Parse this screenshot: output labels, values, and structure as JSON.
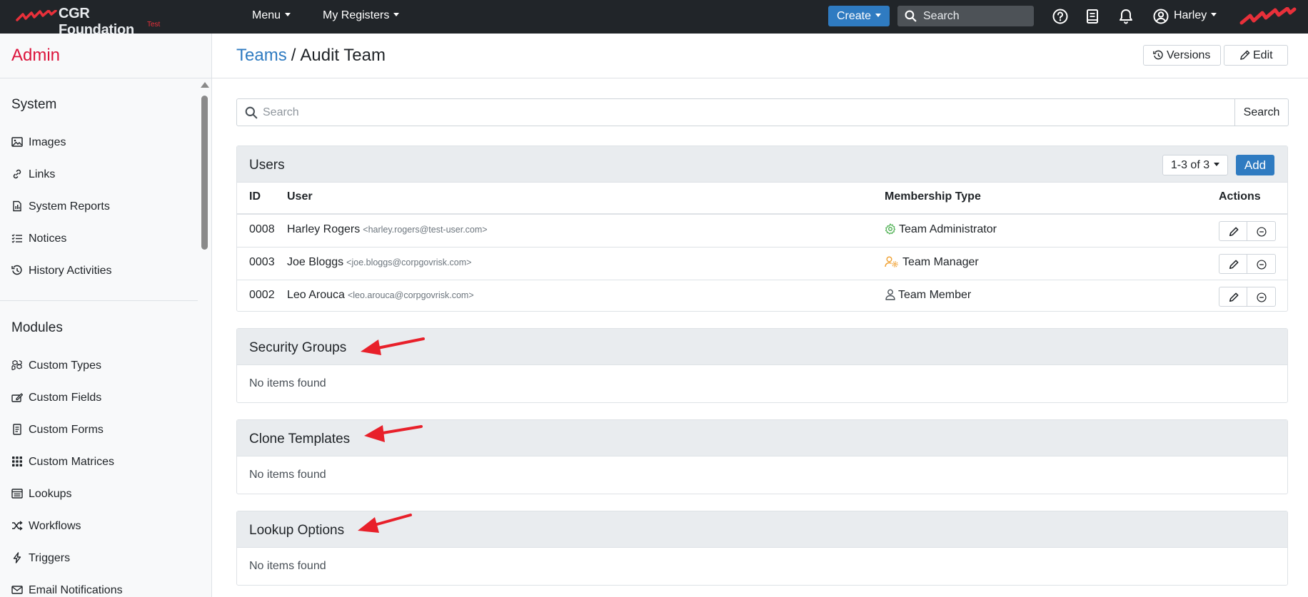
{
  "navbar": {
    "brand_name": "CGR Foundation",
    "brand_env": "Test",
    "menu_label": "Menu",
    "registers_label": "My Registers",
    "create_label": "Create",
    "search_placeholder": "Search",
    "user_label": "Harley",
    "icons": [
      "help-icon",
      "book-icon",
      "bell-icon",
      "user-circle-icon"
    ]
  },
  "sidebar": {
    "title": "Admin",
    "sections": [
      {
        "heading": "System",
        "items": [
          {
            "label": "Images",
            "icon": "image-icon"
          },
          {
            "label": "Links",
            "icon": "link-icon"
          },
          {
            "label": "System Reports",
            "icon": "report-icon"
          },
          {
            "label": "Notices",
            "icon": "list-check-icon"
          },
          {
            "label": "History Activities",
            "icon": "history-icon"
          }
        ]
      },
      {
        "heading": "Modules",
        "items": [
          {
            "label": "Custom Types",
            "icon": "boxes-icon"
          },
          {
            "label": "Custom Fields",
            "icon": "edit-field-icon"
          },
          {
            "label": "Custom Forms",
            "icon": "form-icon"
          },
          {
            "label": "Custom Matrices",
            "icon": "grid-icon"
          },
          {
            "label": "Lookups",
            "icon": "lookup-icon"
          },
          {
            "label": "Workflows",
            "icon": "shuffle-icon"
          },
          {
            "label": "Triggers",
            "icon": "lightning-icon"
          },
          {
            "label": "Email Notifications",
            "icon": "envelope-icon"
          }
        ]
      }
    ]
  },
  "header": {
    "breadcrumb_parent": "Teams",
    "breadcrumb_separator": "/",
    "breadcrumb_current": "Audit Team",
    "versions_label": "Versions",
    "edit_label": "Edit"
  },
  "search": {
    "placeholder": "Search",
    "button_label": "Search"
  },
  "users_panel": {
    "title": "Users",
    "pager_label": "1-3 of 3",
    "add_label": "Add",
    "columns": [
      "ID",
      "User",
      "Membership Type",
      "Actions"
    ],
    "rows": [
      {
        "id": "0008",
        "name": "Harley Rogers",
        "email": "<harley.rogers@test-user.com>",
        "membership": "Team Administrator",
        "membership_icon": "gear-icon"
      },
      {
        "id": "0003",
        "name": "Joe Bloggs",
        "email": "<joe.bloggs@corpgovrisk.com>",
        "membership": "Team Manager",
        "membership_icon": "user-gear-icon"
      },
      {
        "id": "0002",
        "name": "Leo Arouca",
        "email": "<leo.arouca@corpgovrisk.com>",
        "membership": "Team Member",
        "membership_icon": "person-icon"
      }
    ]
  },
  "panels": [
    {
      "title": "Security Groups",
      "empty_text": "No items found"
    },
    {
      "title": "Clone Templates",
      "empty_text": "No items found"
    },
    {
      "title": "Lookup Options",
      "empty_text": "No items found"
    }
  ],
  "colors": {
    "navbar": "#212529",
    "primary": "#2f7bc1",
    "admin_title": "#dc143c",
    "annotation_arrow": "#e8202a",
    "admin_icon": "#4caf50",
    "manager_icon": "#f0a030"
  }
}
